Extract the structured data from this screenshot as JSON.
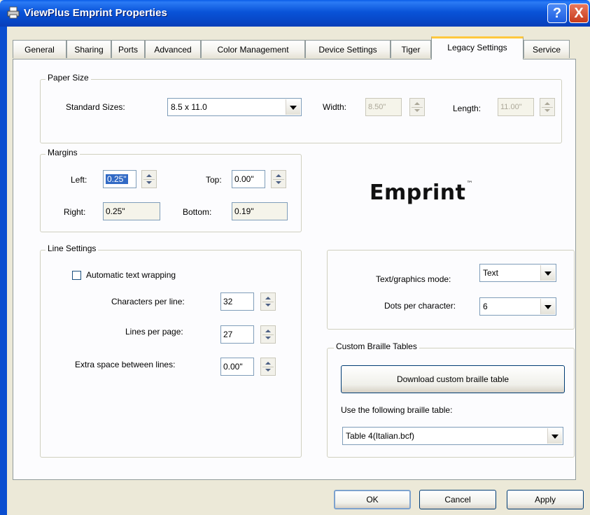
{
  "window": {
    "title": "ViewPlus Emprint Properties",
    "help_glyph": "?",
    "close_glyph": "X"
  },
  "tabs": [
    {
      "label": "General",
      "active": false
    },
    {
      "label": "Sharing",
      "active": false
    },
    {
      "label": "Ports",
      "active": false
    },
    {
      "label": "Advanced",
      "active": false
    },
    {
      "label": "Color Management",
      "active": false
    },
    {
      "label": "Device Settings",
      "active": false
    },
    {
      "label": "Tiger",
      "active": false
    },
    {
      "label": "Legacy Settings",
      "active": true
    },
    {
      "label": "Service",
      "active": false
    }
  ],
  "paper_size": {
    "group_label": "Paper Size",
    "standard_sizes_label": "Standard Sizes:",
    "standard_sizes_value": "8.5 x 11.0",
    "width_label": "Width:",
    "width_value": "8.50\"",
    "length_label": "Length:",
    "length_value": "11.00\""
  },
  "margins": {
    "group_label": "Margins",
    "left_label": "Left:",
    "left_value": "0.25\"",
    "top_label": "Top:",
    "top_value": "0.00\"",
    "right_label": "Right:",
    "right_value": "0.25\"",
    "bottom_label": "Bottom:",
    "bottom_value": "0.19\""
  },
  "brand": {
    "logo_text": "Emprint",
    "tm": "™"
  },
  "line_settings": {
    "group_label": "Line Settings",
    "auto_wrap_label": "Automatic text wrapping",
    "auto_wrap_checked": false,
    "chars_per_line_label": "Characters per line:",
    "chars_per_line_value": "32",
    "lines_per_page_label": "Lines per page:",
    "lines_per_page_value": "27",
    "extra_space_label": "Extra space between lines:",
    "extra_space_value": "0.00\""
  },
  "mode": {
    "text_graphics_label": "Text/graphics mode:",
    "text_graphics_value": "Text",
    "dots_per_char_label": "Dots per character:",
    "dots_per_char_value": "6"
  },
  "braille": {
    "group_label": "Custom Braille Tables",
    "download_button": "Download custom braille table",
    "use_table_label": "Use the following braille table:",
    "table_value": "Table 4(Italian.bcf)"
  },
  "footer": {
    "ok": "OK",
    "cancel": "Cancel",
    "apply": "Apply"
  }
}
